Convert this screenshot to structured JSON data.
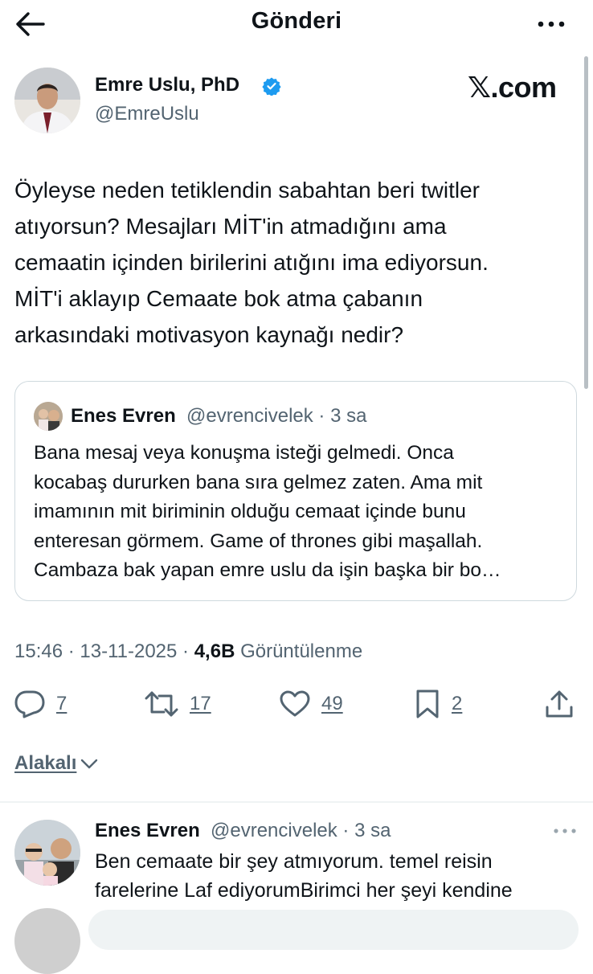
{
  "header": {
    "title": "Gönderi"
  },
  "post": {
    "author_name": "Emre Uslu, PhD",
    "handle": "@EmreUslu",
    "watermark": "𝕏.com",
    "text": "Öyleyse neden tetiklendin sabahtan beri twitler\natıyorsun? Mesajları MİT'in atmadığını ama\ncemaatin içinden birilerini atığını ima ediyorsun.\nMİT'i aklayıp Cemaate bok atma çabanın\narkasındaki motivasyon kaynağı nedir?",
    "time": "15:46",
    "date": "13-11-2025",
    "views": "4,6B",
    "views_label": "Görüntülenme"
  },
  "quote": {
    "name": "Enes Evren",
    "meta": "@evrencivelek · 3 sa",
    "text": "Bana mesaj veya konuşma isteği gelmedi. Onca\nkocabaş dururken bana sıra gelmez zaten. Ama mit\nimamının mit biriminin olduğu cemaat içinde bunu\nenteresan görmem. Game of thrones gibi maşallah.\nCambaza bak yapan emre uslu da işin başka bir bo…"
  },
  "actions": {
    "replies": "7",
    "reposts": "17",
    "likes": "49",
    "bookmarks": "2"
  },
  "sort": {
    "label": "Alakalı"
  },
  "reply": {
    "name": "Enes Evren",
    "meta": "@evrencivelek · 3 sa",
    "text": "Ben cemaate bir şey atmıyorum. temel reisin\nfarelerine Laf ediyorumBirimci her şeyi kendine"
  },
  "colors": {
    "accent": "#1d9bf0",
    "secondary_text": "#536471",
    "primary_text": "#0f1419",
    "border": "#cfd9de"
  }
}
